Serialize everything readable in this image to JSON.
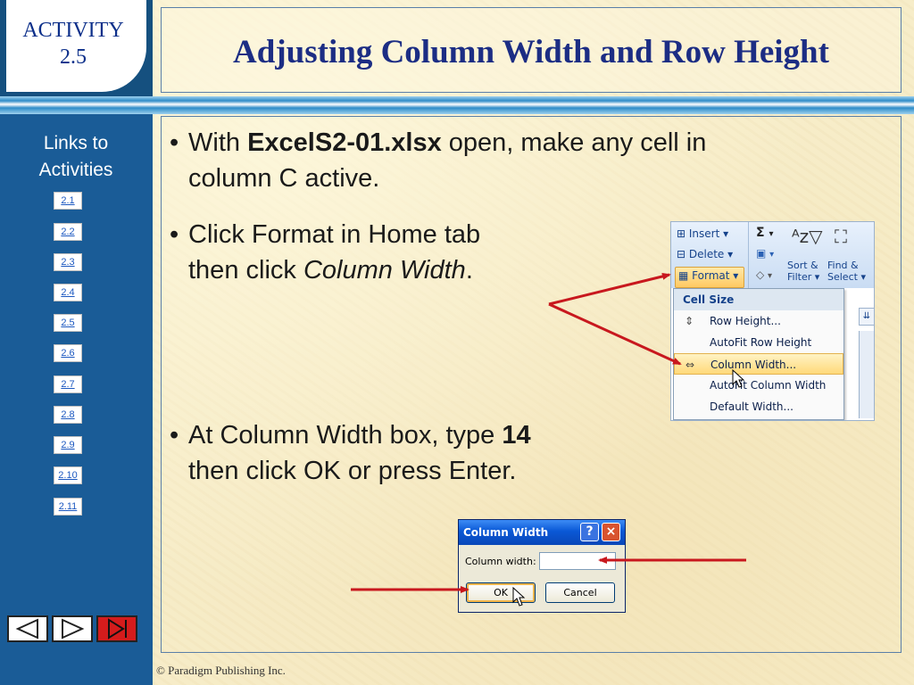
{
  "slide": {
    "activity_label": "ACTIVITY",
    "activity_number": "2.5",
    "title": "Adjusting Column Width and Row Height",
    "footer": "© Paradigm Publishing Inc."
  },
  "sidebar": {
    "links_title": "Links to Activities",
    "links": [
      "2.1",
      "2.2",
      "2.3",
      "2.4",
      "2.5",
      "2.6",
      "2.7",
      "2.8",
      "2.9",
      "2.10",
      "2.11"
    ]
  },
  "bullets": {
    "b1_pre": "With ",
    "b1_bold": "ExcelS2-01.xlsx",
    "b1_post": " open, make any cell in",
    "b1_line2": "column C active.",
    "b2_line1": "Click Format in Home tab",
    "b2_pre": "then click ",
    "b2_italic": "Column Width",
    "b2_post": ".",
    "b3_pre": "At Column Width box, type ",
    "b3_bold": "14",
    "b3_line2": "then click OK or press Enter."
  },
  "ribbon": {
    "insert": "Insert",
    "delete": "Delete",
    "format": "Format",
    "sort_filter_1": "Sort &",
    "sort_filter_2": "Filter",
    "find_select_1": "Find &",
    "find_select_2": "Select",
    "menu_header": "Cell Size",
    "menu_items": [
      "Row Height...",
      "AutoFit Row Height",
      "Column Width...",
      "AutoFit Column Width",
      "Default Width..."
    ]
  },
  "dialog": {
    "title": "Column Width",
    "field_label": "Column width:",
    "field_value": "",
    "help": "?",
    "close": "×",
    "ok": "OK",
    "cancel": "Cancel"
  },
  "colors": {
    "sidebar": "#1a5c97",
    "title_text": "#1c2d84",
    "arrow": "#c8181e",
    "background": "#f7edc9"
  }
}
